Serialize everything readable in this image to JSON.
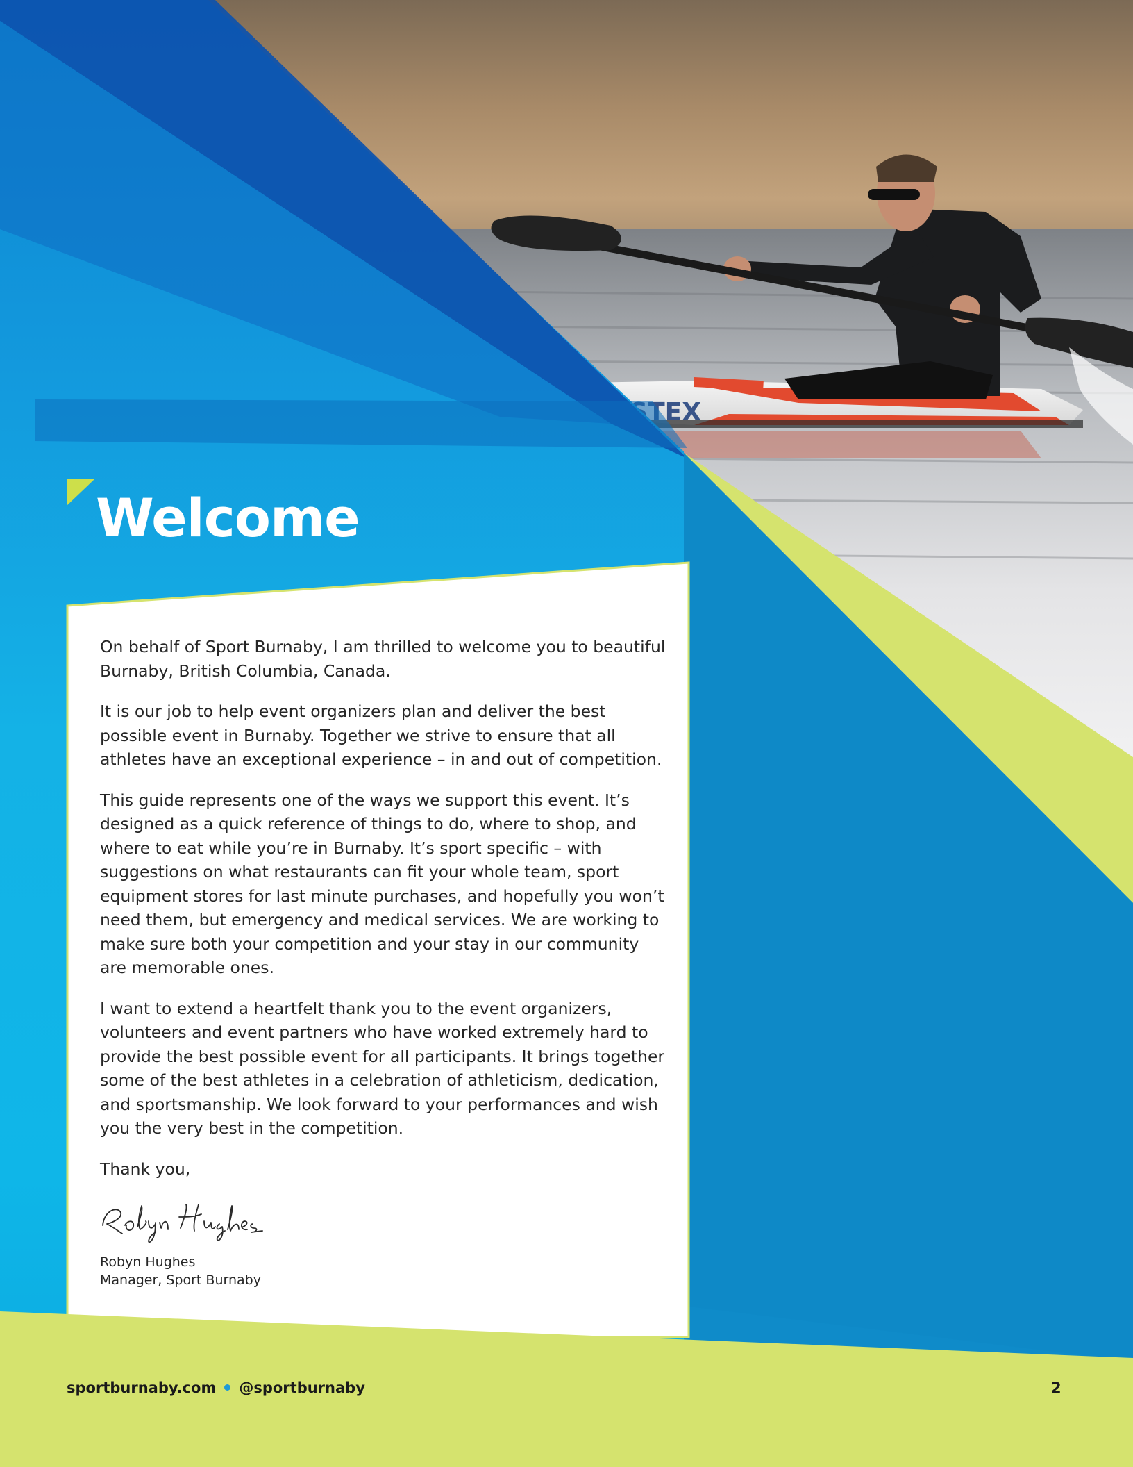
{
  "welcome": {
    "title": "Welcome"
  },
  "letter": {
    "paragraphs": [
      "On behalf of Sport Burnaby, I am thrilled to welcome you to beautiful Burnaby, British Columbia, Canada.",
      "It is our job to help event organizers plan and deliver the best possible event in Burnaby. Together we strive to ensure that all athletes have an exceptional experience – in and out of competition.",
      "This guide represents one of the ways we support this event. It’s designed as a quick reference of things to do, where to shop, and where to eat while you’re in Burnaby. It’s sport specific – with suggestions on what restaurants can fit your whole team, sport equipment stores for last minute purchases, and hopefully you won’t need them, but emergency and medical services. We are working to make sure both your competition and your stay in our community are memorable ones.",
      "I want to extend a heartfelt thank you to the event organizers, volunteers and event partners who have worked extremely hard to provide the best possible event for all participants. It brings together some of the best athletes in a celebration of athleticism, dedication, and sportsmanship. We look forward to your performances and wish you the very best in the competition."
    ],
    "closing": "Thank you,",
    "signature_text": "Robyn Hughes",
    "signer_name": "Robyn Hughes",
    "signer_title": "Manager, Sport Burnaby"
  },
  "kayak": {
    "brand_text": "PLASTEX"
  },
  "footer": {
    "website": "sportburnaby.com",
    "social": "@sportburnaby",
    "page_number": "2"
  },
  "colors": {
    "blue_dark": "#0d4fa8",
    "blue_mid": "#0f8bc9",
    "cyan": "#12b8e6",
    "lime": "#d5e36e",
    "lime_accent": "#cddf4a",
    "text": "#262626"
  },
  "icons": [
    "welcome-marker-triangle",
    "footer-dot"
  ]
}
